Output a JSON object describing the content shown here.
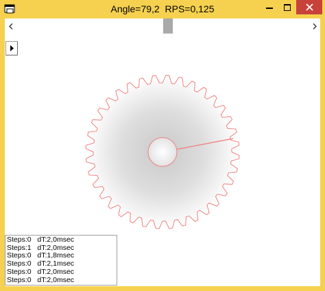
{
  "window": {
    "title": "Angle=79,2  RPS=0,125"
  },
  "controls": {
    "scroll_left_icon": "chevron-left-icon",
    "scroll_right_icon": "chevron-right-icon",
    "play_icon": "play-icon"
  },
  "scrollbar": {
    "position_fraction": 0.52
  },
  "gear": {
    "teeth": 36,
    "angle_deg": 79.2,
    "outline_color": "#f08080",
    "indicator_color": "#f08080"
  },
  "log": {
    "lines": [
      "Steps:0   dT:2,0msec",
      "Steps:1   dT:2,0msec",
      "Steps:0   dT:1,8msec",
      "Steps:0   dT:2,1msec",
      "Steps:0   dT:2,0msec",
      "Steps:0   dT:2,0msec"
    ]
  }
}
